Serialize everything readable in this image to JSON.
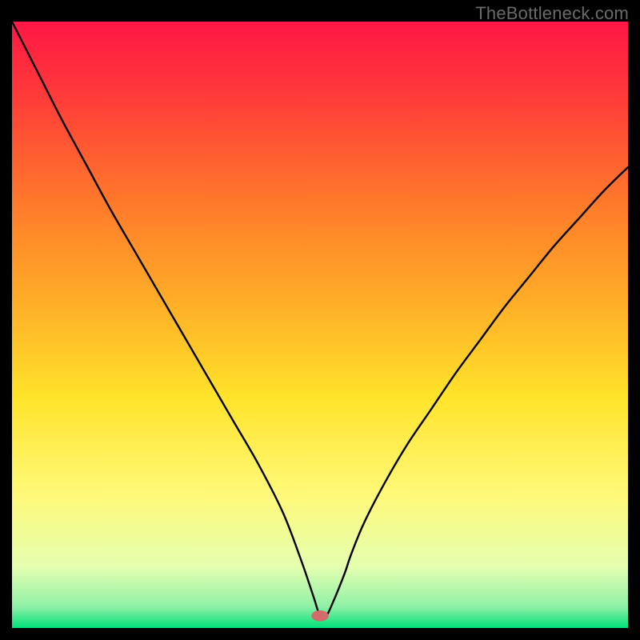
{
  "watermark": "TheBottleneck.com",
  "chart_data": {
    "type": "line",
    "title": "",
    "xlabel": "",
    "ylabel": "",
    "xlim": [
      0,
      100
    ],
    "ylim": [
      0,
      100
    ],
    "grid": false,
    "legend": false,
    "background_gradient": {
      "stops": [
        {
          "offset": 0.0,
          "color": "#ff1744"
        },
        {
          "offset": 0.12,
          "color": "#ff3a3a"
        },
        {
          "offset": 0.3,
          "color": "#ff7a2a"
        },
        {
          "offset": 0.48,
          "color": "#ffb327"
        },
        {
          "offset": 0.62,
          "color": "#ffe42a"
        },
        {
          "offset": 0.78,
          "color": "#fff97a"
        },
        {
          "offset": 0.9,
          "color": "#e4ffb0"
        },
        {
          "offset": 0.965,
          "color": "#8ef0a6"
        },
        {
          "offset": 1.0,
          "color": "#00e07a"
        }
      ]
    },
    "curve": {
      "x": [
        0,
        2,
        5,
        8,
        12,
        16,
        20,
        24,
        28,
        32,
        36,
        40,
        44,
        47,
        49,
        50,
        51,
        52,
        54,
        55,
        57,
        60,
        64,
        68,
        72,
        76,
        80,
        84,
        88,
        92,
        96,
        100
      ],
      "y": [
        100,
        96,
        90,
        84,
        76.5,
        69,
        62,
        55,
        48,
        41,
        34,
        27,
        19,
        11,
        5,
        2,
        2,
        4,
        9,
        12,
        17,
        23,
        30,
        36,
        42,
        47.5,
        53,
        58,
        63,
        67.5,
        72,
        76
      ]
    },
    "floor": {
      "x": [
        49,
        52
      ],
      "y": 2
    },
    "marker": {
      "x": 50,
      "y": 2,
      "rx": 1.4,
      "ry": 0.9,
      "color": "#d46a6a"
    }
  }
}
